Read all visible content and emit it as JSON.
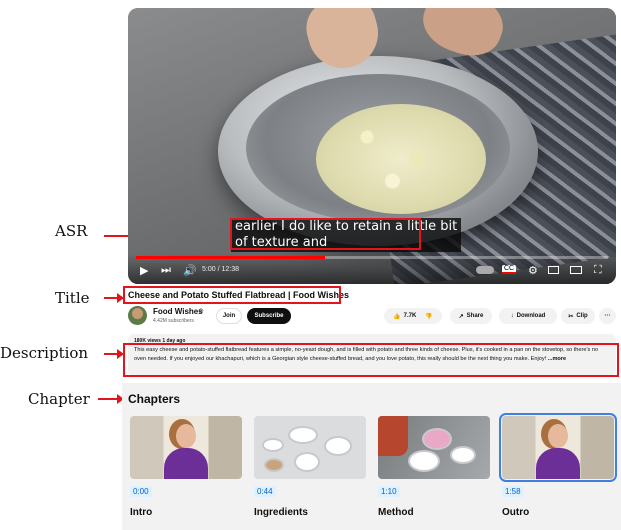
{
  "annotations": {
    "asr": "ASR",
    "title": "Title",
    "description": "Description",
    "chapter": "Chapter"
  },
  "player": {
    "caption_line1": "earlier I do like to retain a little bit",
    "caption_line2": "of texture and",
    "time": "5:00 / 12:38",
    "progress": 0.4
  },
  "video": {
    "title": "Cheese and Potato Stuffed Flatbread | Food Wishes"
  },
  "channel": {
    "name": "Food Wishes",
    "subscribers": "4.42M subscribers",
    "join_label": "Join",
    "subscribe_label": "Subscribe"
  },
  "actions": {
    "likes": "7.7K",
    "share_label": "Share",
    "download_label": "Download",
    "clip_label": "Clip",
    "more_label": "···"
  },
  "description": {
    "meta": "180K views  1 day ago",
    "text": "This easy cheese and potato-stuffed flatbread features a simple, no-yeast dough, and is filled with potato and three kinds of cheese. Plus, it's cooked in a pan on the stovetop, so there's no oven needed. If you enjoyed our khachapuri, which is a Georgian style cheese-stuffed bread, and you love potato, this really should be the next thing you make. Enjoy!",
    "more_label": "...more"
  },
  "chapters": {
    "heading": "Chapters",
    "items": [
      {
        "time": "0:00",
        "name": "Intro"
      },
      {
        "time": "0:44",
        "name": "Ingredients"
      },
      {
        "time": "1:10",
        "name": "Method"
      },
      {
        "time": "1:58",
        "name": "Outro"
      }
    ],
    "selected_index": 3
  },
  "colors": {
    "annotation_red": "#e3141c",
    "progress_red": "#ff0000",
    "link_blue": "#065fd4"
  }
}
